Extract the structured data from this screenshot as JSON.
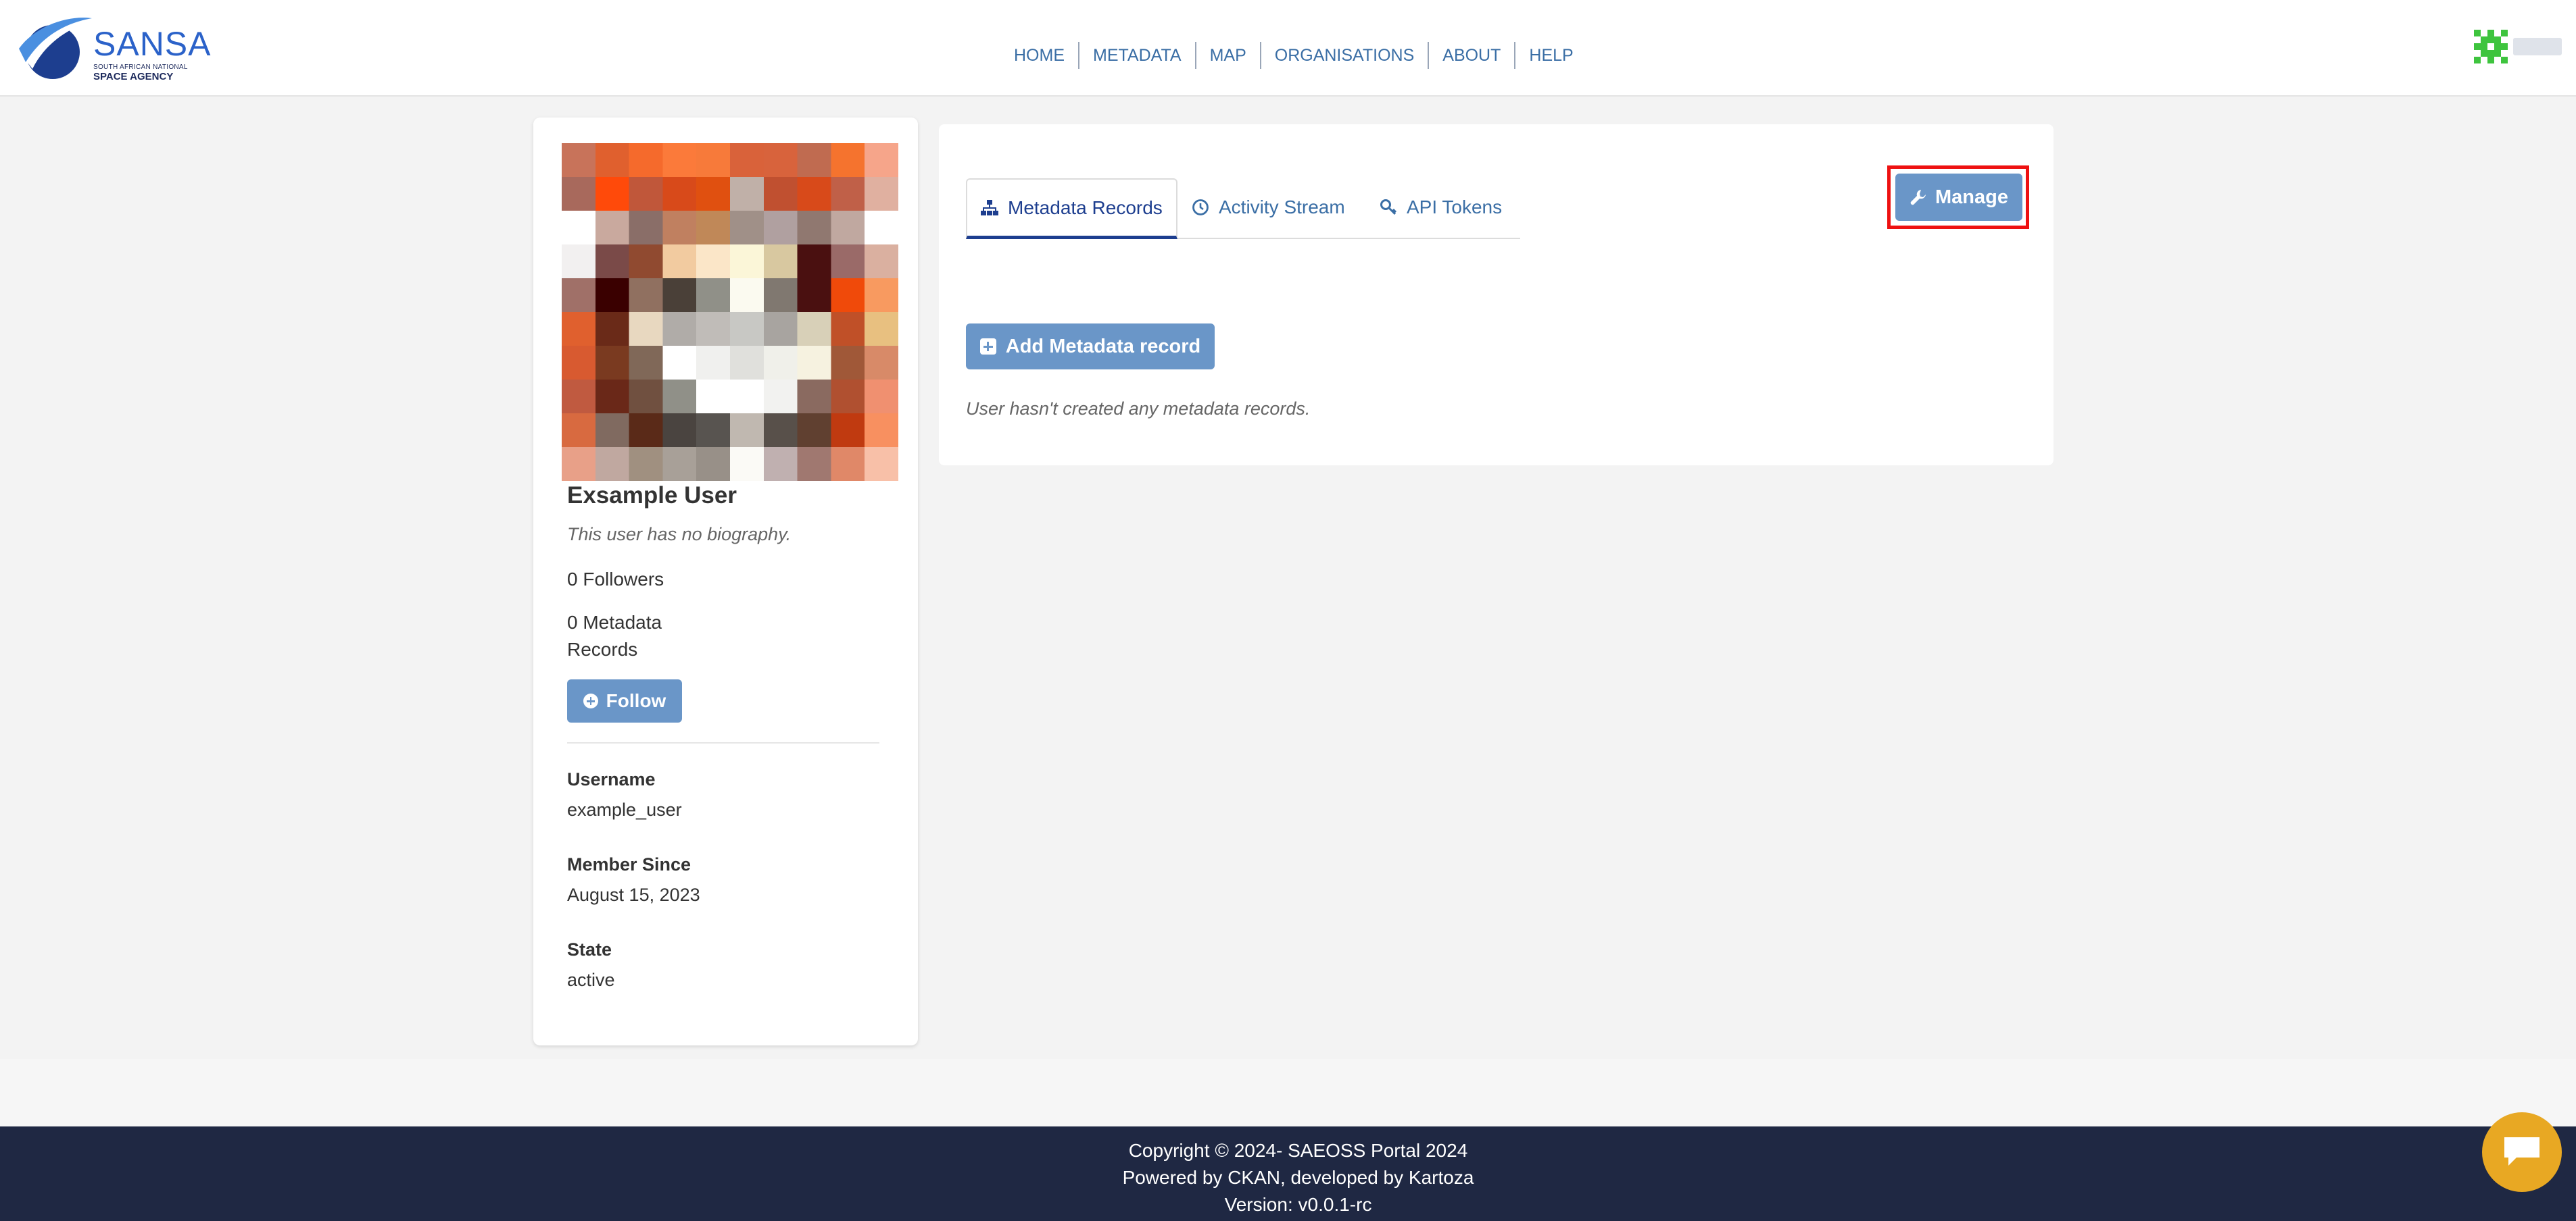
{
  "header": {
    "logo": {
      "name": "SANSA",
      "subtitle": "SOUTH AFRICAN NATIONAL",
      "agency": "SPACE AGENCY"
    },
    "nav": [
      "HOME",
      "METADATA",
      "MAP",
      "ORGANISATIONS",
      "ABOUT",
      "HELP"
    ]
  },
  "profile": {
    "name": "Exsample User",
    "bio": "This user has no biography.",
    "followers": "0 Followers",
    "records": "0 Metadata Records",
    "follow_label": "Follow",
    "fields": [
      {
        "label": "Username",
        "value": "example_user"
      },
      {
        "label": "Member Since",
        "value": "August 15, 2023"
      },
      {
        "label": "State",
        "value": "active"
      }
    ]
  },
  "main": {
    "tabs": [
      {
        "label": "Metadata Records",
        "icon": "sitemap-icon",
        "active": true
      },
      {
        "label": "Activity Stream",
        "icon": "clock-icon",
        "active": false
      },
      {
        "label": "API Tokens",
        "icon": "key-icon",
        "active": false
      }
    ],
    "manage_label": "Manage",
    "add_label": "Add Metadata record",
    "empty_message": "User hasn't created any metadata records."
  },
  "footer": {
    "copyright": "Copyright © 2024- SAEOSS Portal 2024",
    "powered": "Powered by CKAN, developed by Kartoza",
    "version": "Version: v0.0.1-rc"
  },
  "colors": {
    "accent": "#6a96c8",
    "nav_text": "#3a6ea5",
    "footer_bg": "#1f2843",
    "highlight": "#ee1111",
    "chat": "#e8a823"
  }
}
